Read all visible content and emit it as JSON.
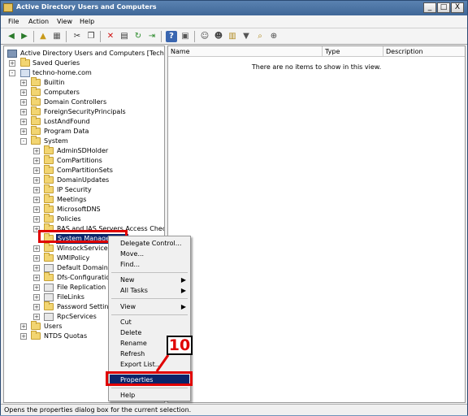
{
  "window": {
    "title": "Active Directory Users and Computers",
    "min_label": "_",
    "max_label": "□",
    "close_label": "X"
  },
  "menu": {
    "items": [
      "File",
      "Action",
      "View",
      "Help"
    ]
  },
  "toolbar": {
    "icons": [
      "back-arrow-icon",
      "forward-arrow-icon",
      "up-folder-icon",
      "show-tree-icon",
      "cut-icon",
      "copy-icon",
      "delete-icon",
      "properties-icon",
      "refresh-icon",
      "export-list-icon",
      "help-icon",
      "console-tree-icon",
      "add-user-icon",
      "add-group-icon",
      "add-ou-icon",
      "filter-icon",
      "find-icon",
      "add-to-group-icon"
    ],
    "glyphs": [
      "◀",
      "▶",
      "▲",
      "▦",
      "✂",
      "❐",
      "✕",
      "▤",
      "↻",
      "⇥",
      "?",
      "▣",
      "☺",
      "☻",
      "▥",
      "▼",
      "⌕",
      "⊕"
    ]
  },
  "tree": {
    "root": "Active Directory Users and Computers [Techno.te",
    "saved_queries": "Saved Queries",
    "domain": "techno-home.com",
    "level1": [
      "Builtin",
      "Computers",
      "Domain Controllers",
      "ForeignSecurityPrincipals",
      "LostAndFound",
      "Program Data",
      "System"
    ],
    "system_children": [
      "AdminSDHolder",
      "ComPartitions",
      "ComPartitionSets",
      "DomainUpdates",
      "IP Security",
      "Meetings",
      "MicrosoftDNS",
      "Policies",
      "RAS and IAS Servers Access Check",
      "System Management",
      "WinsockServices",
      "WMIPolicy",
      "Default Domain Po",
      "Dfs-Configuration",
      "File Replication Ser",
      "FileLinks",
      "Password Settings",
      "RpcServices"
    ],
    "after_system": [
      "Users",
      "NTDS Quotas"
    ]
  },
  "list": {
    "columns": [
      "Name",
      "Type",
      "Description"
    ],
    "empty_message": "There are no items to show in this view."
  },
  "context_menu": {
    "items": [
      "Delegate Control...",
      "Move...",
      "Find...",
      "New",
      "All Tasks",
      "View",
      "Cut",
      "Delete",
      "Rename",
      "Refresh",
      "Export List...",
      "Properties",
      "Help"
    ],
    "submenu_arrow": "▶"
  },
  "callout": {
    "step": "10"
  },
  "status": {
    "text": "Opens the properties dialog box for the current selection."
  },
  "colors": {
    "highlight": "#0a246a",
    "annotation_red": "#e00000",
    "title_bar": "#4a74a5"
  }
}
